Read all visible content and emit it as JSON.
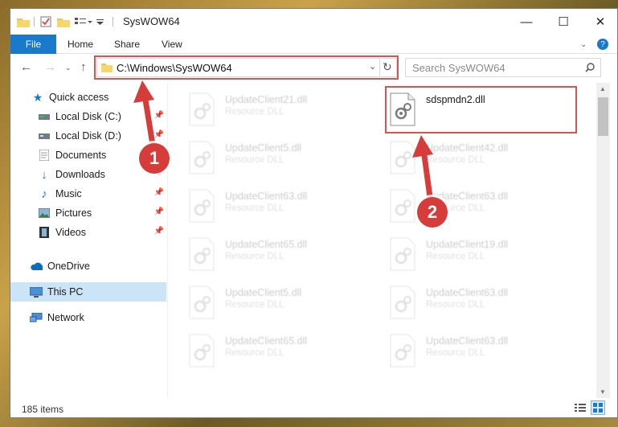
{
  "window": {
    "title": "SysWOW64",
    "controls": {
      "minimize": "—",
      "maximize": "☐",
      "close": "✕"
    }
  },
  "ribbon": {
    "tabs": [
      "File",
      "Home",
      "Share",
      "View"
    ],
    "help": "?"
  },
  "address": {
    "path": "C:\\Windows\\SysWOW64",
    "search_placeholder": "Search SysWOW64"
  },
  "nav": {
    "items": [
      {
        "label": "Quick access",
        "icon": "star-icon",
        "pinned": false
      },
      {
        "label": "Local Disk (C:)",
        "icon": "drive-icon",
        "pinned": true
      },
      {
        "label": "Local Disk (D:)",
        "icon": "drive-icon",
        "pinned": true
      },
      {
        "label": "Documents",
        "icon": "document-icon",
        "pinned": true
      },
      {
        "label": "Downloads",
        "icon": "download-icon",
        "pinned": true
      },
      {
        "label": "Music",
        "icon": "music-icon",
        "pinned": true
      },
      {
        "label": "Pictures",
        "icon": "pictures-icon",
        "pinned": true
      },
      {
        "label": "Videos",
        "icon": "video-icon",
        "pinned": true
      },
      {
        "label": "OneDrive",
        "icon": "cloud-icon",
        "pinned": false
      },
      {
        "label": "This PC",
        "icon": "computer-icon",
        "pinned": false,
        "selected": true
      },
      {
        "label": "Network",
        "icon": "network-icon",
        "pinned": false
      }
    ]
  },
  "files": {
    "left": [
      {
        "name": "UpdateClient21.dll",
        "type": "Resource DLL"
      },
      {
        "name": "UpdateClient5.dll",
        "type": "Resource DLL"
      },
      {
        "name": "UpdateClient63.dll",
        "type": "Resource DLL"
      },
      {
        "name": "UpdateClient65.dll",
        "type": "Resource DLL"
      },
      {
        "name": "UpdateClient5.dll",
        "type": "Resource DLL"
      },
      {
        "name": "UpdateClient65.dll",
        "type": "Resource DLL"
      }
    ],
    "right": [
      {
        "name": "sdspmdn2.dll",
        "type": "",
        "highlighted": true
      },
      {
        "name": "UpdateClient42.dll",
        "type": "Resource DLL"
      },
      {
        "name": "UpdateClient63.dll",
        "type": "Resource DLL"
      },
      {
        "name": "UpdateClient19.dll",
        "type": "Resource DLL"
      },
      {
        "name": "UpdateClient63.dll",
        "type": "Resource DLL"
      },
      {
        "name": "UpdateClient63.dll",
        "type": "Resource DLL"
      }
    ]
  },
  "status": {
    "item_count": "185 items"
  },
  "annotations": {
    "step1": "1",
    "step2": "2",
    "color": "#d63d3a"
  }
}
